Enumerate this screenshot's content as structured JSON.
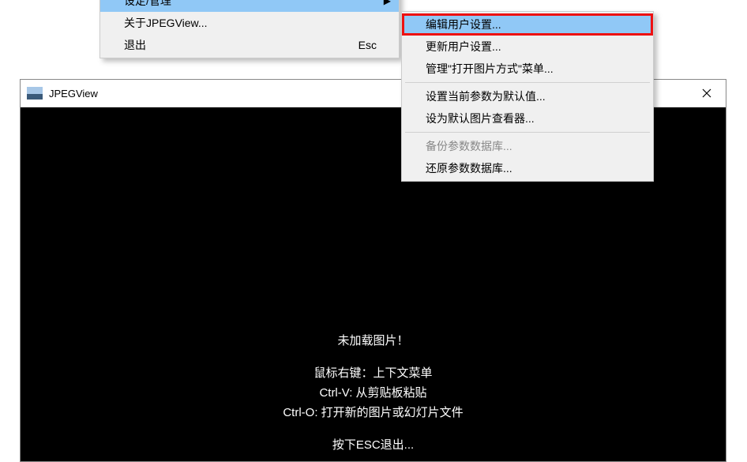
{
  "window": {
    "title": "JPEGView"
  },
  "viewport": {
    "heading": "未加载图片！",
    "hint1": "鼠标右键：上下文菜单",
    "hint2": "Ctrl-V: 从剪贴板粘贴",
    "hint3": "Ctrl-O: 打开新的图片或幻灯片文件",
    "hint4": "按下ESC退出..."
  },
  "main_menu": {
    "items": [
      {
        "label": "设定/管理",
        "has_sub": true
      },
      {
        "label": "关于JPEGView..."
      },
      {
        "label": "退出",
        "shortcut": "Esc"
      }
    ]
  },
  "sub_menu": {
    "items": [
      {
        "label": "编辑用户设置..."
      },
      {
        "label": "更新用户设置..."
      },
      {
        "label": "管理\"打开图片方式\"菜单..."
      },
      {
        "label": "设置当前参数为默认值..."
      },
      {
        "label": "设为默认图片查看器..."
      },
      {
        "label": "备份参数数据库...",
        "disabled": true
      },
      {
        "label": "还原参数数据库..."
      }
    ]
  }
}
